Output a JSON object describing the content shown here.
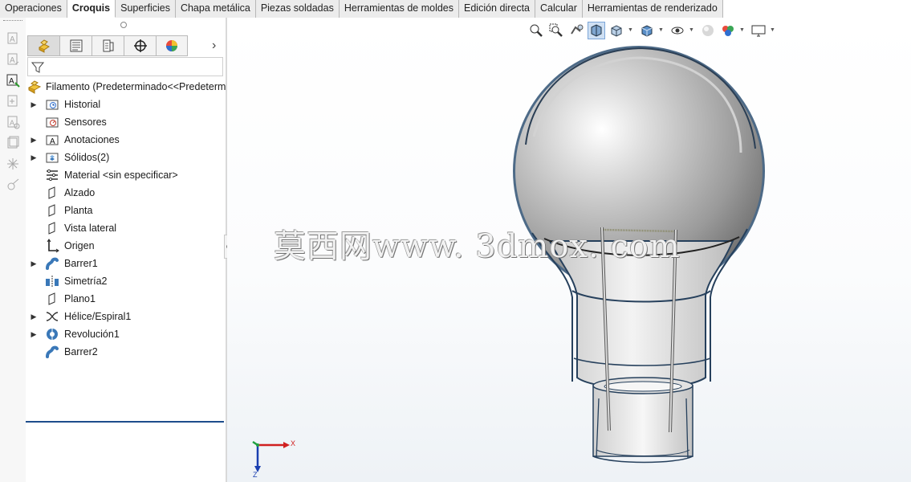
{
  "tabs": [
    {
      "label": "Operaciones"
    },
    {
      "label": "Croquis",
      "active": true
    },
    {
      "label": "Superficies"
    },
    {
      "label": "Chapa metálica"
    },
    {
      "label": "Piezas soldadas"
    },
    {
      "label": "Herramientas de moldes"
    },
    {
      "label": "Edición directa"
    },
    {
      "label": "Calcular"
    },
    {
      "label": "Herramientas de renderizado"
    }
  ],
  "feature_manager": {
    "tabs": [
      "feature-manager-icon",
      "property-manager-icon",
      "configuration-manager-icon",
      "dimxpert-icon",
      "display-manager-icon"
    ],
    "root": {
      "label": "Filamento  (Predeterminado<<Predeterminado",
      "icon": "part-icon"
    },
    "nodes": [
      {
        "label": "Historial",
        "icon": "history-folder-icon",
        "expandable": true
      },
      {
        "label": "Sensores",
        "icon": "sensors-folder-icon",
        "expandable": false
      },
      {
        "label": "Anotaciones",
        "icon": "annotations-folder-icon",
        "expandable": true
      },
      {
        "label": "Sólidos(2)",
        "icon": "solid-bodies-folder-icon",
        "expandable": true
      },
      {
        "label": "Material <sin especificar>",
        "icon": "material-icon",
        "expandable": false
      },
      {
        "label": "Alzado",
        "icon": "plane-icon",
        "expandable": false
      },
      {
        "label": "Planta",
        "icon": "plane-icon",
        "expandable": false
      },
      {
        "label": "Vista lateral",
        "icon": "plane-icon",
        "expandable": false
      },
      {
        "label": "Origen",
        "icon": "origin-icon",
        "expandable": false
      },
      {
        "label": "Barrer1",
        "icon": "sweep-icon",
        "expandable": true
      },
      {
        "label": "Simetría2",
        "icon": "mirror-icon",
        "expandable": false
      },
      {
        "label": "Plano1",
        "icon": "plane-icon",
        "expandable": false
      },
      {
        "label": "Hélice/Espiral1",
        "icon": "helix-icon",
        "expandable": true
      },
      {
        "label": "Revolución1",
        "icon": "revolve-icon",
        "expandable": true
      },
      {
        "label": "Barrer2",
        "icon": "sweep-icon",
        "expandable": false
      }
    ]
  },
  "viewport": {
    "watermark": "莫西网www. 3dmox. com",
    "triad": {
      "x_label": "X",
      "z_label": "Z"
    },
    "heads_up_toolbar": [
      "zoom-to-fit-icon",
      "zoom-to-area-icon",
      "previous-view-icon",
      "section-view-icon",
      "view-orientation-icon",
      "display-style-icon",
      "hide-show-items-icon",
      "edit-appearance-icon",
      "apply-scene-icon",
      "view-settings-icon"
    ]
  },
  "colors": {
    "accent": "#1e4d8c",
    "feature_icon": "#3a78b8",
    "part_icon": "#e0a21a"
  }
}
